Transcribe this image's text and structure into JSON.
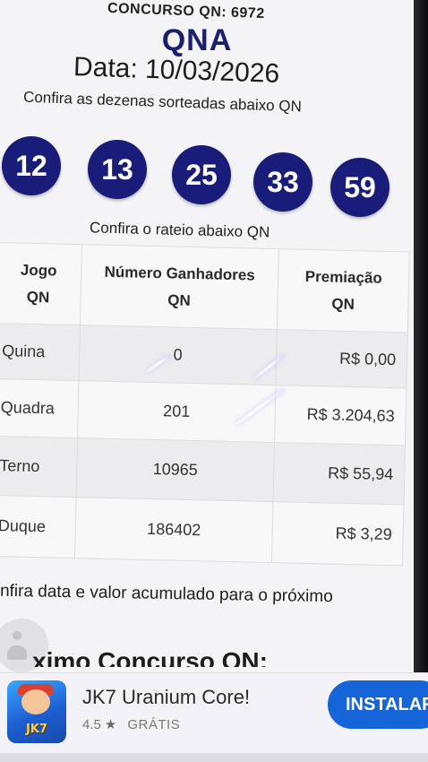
{
  "header": {
    "concurso": "CONCURSO QN: 6972",
    "brand": "QNA",
    "date_line": "Data: 10/03/2026",
    "intro": "Confira as dezenas sorteadas abaixo QN"
  },
  "balls": [
    "12",
    "13",
    "25",
    "33",
    "59"
  ],
  "colors": {
    "ball": "#1a1c7a",
    "brand": "#1b1f6e",
    "install_button": "#1565d8"
  },
  "rateio_title": "Confira o rateio abaixo QN",
  "table": {
    "headers": {
      "jogo_l1": "Jogo",
      "jogo_l2": "QN",
      "ganhadores_l1": "Número Ganhadores",
      "ganhadores_l2": "QN",
      "premiacao_l1": "Premiação",
      "premiacao_l2": "QN"
    },
    "rows": [
      {
        "jogo": "Quina",
        "ganhadores": "0",
        "premiacao": "R$ 0,00"
      },
      {
        "jogo": "Quadra",
        "ganhadores": "201",
        "premiacao": "R$ 3.204,63"
      },
      {
        "jogo": "Terno",
        "ganhadores": "10965",
        "premiacao": "R$ 55,94"
      },
      {
        "jogo": "Duque",
        "ganhadores": "186402",
        "premiacao": "R$ 3,29"
      }
    ]
  },
  "next_info": "nfira data e valor acumulado para o próximo",
  "next_heading": "ximo Concurso QN:",
  "ad": {
    "icon": "game-app-icon",
    "icon_text": "JK7",
    "title": "JK7 Uranium Core!",
    "rating": "4.5",
    "star_icon": "star-icon",
    "price": "GRÁTIS",
    "install_label": "INSTALAR"
  }
}
